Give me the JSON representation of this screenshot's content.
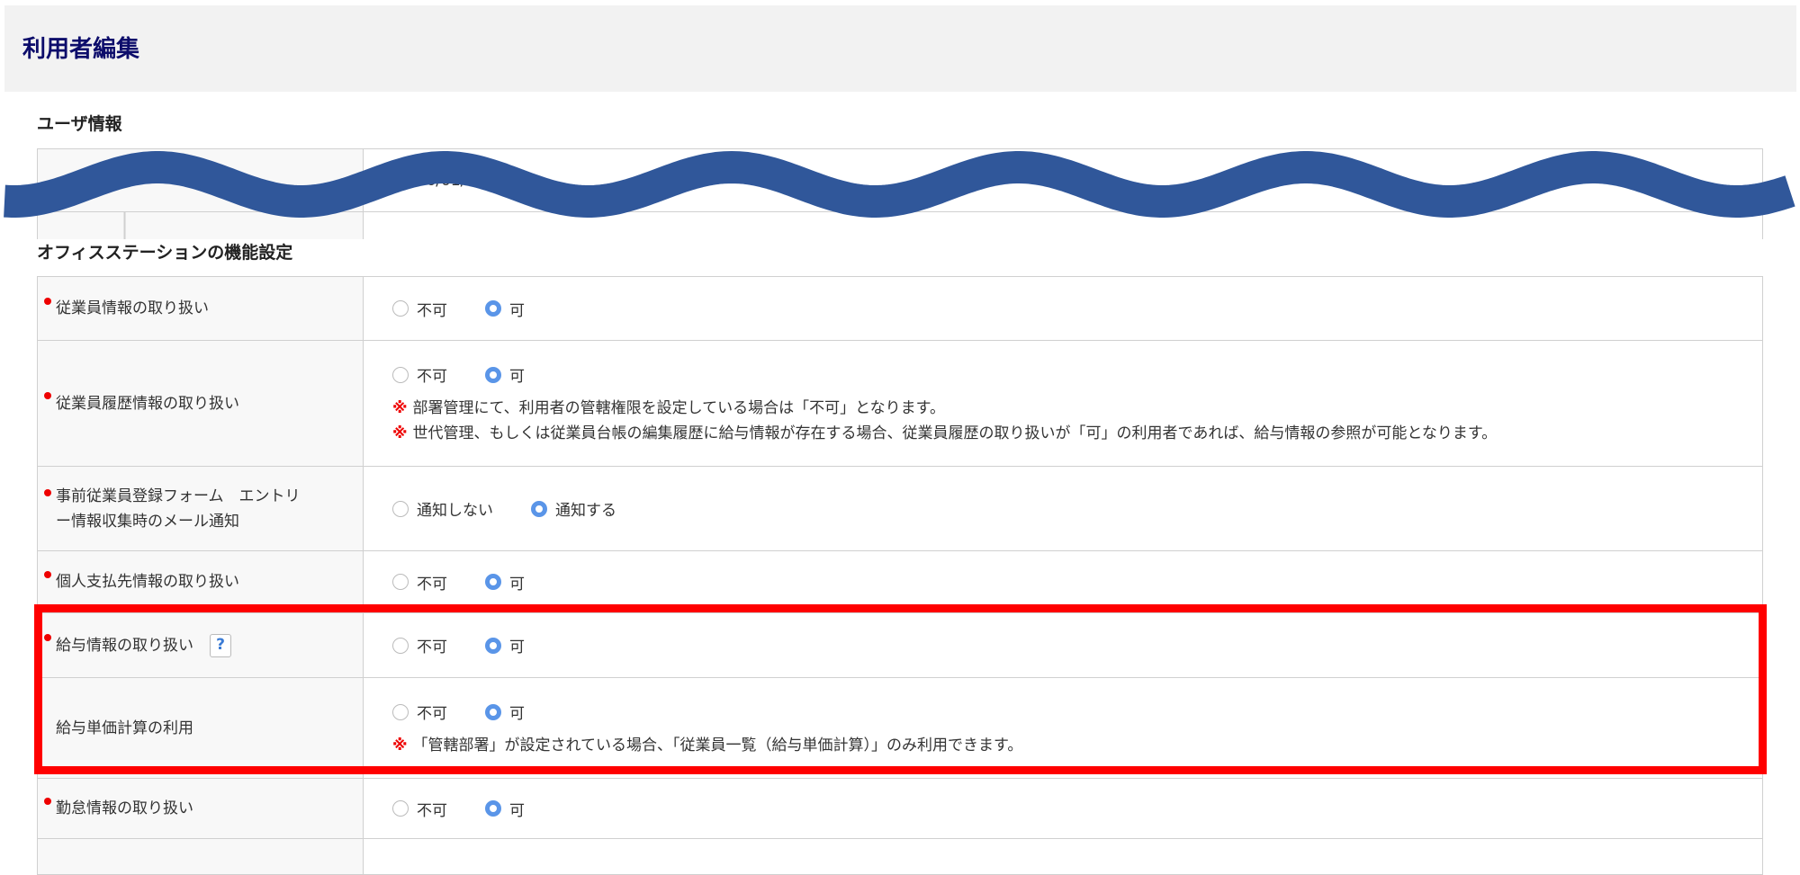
{
  "header": {
    "title": "利用者編集"
  },
  "user_info": {
    "heading": "ユーザ情報",
    "date_value": "2026/01/"
  },
  "functions": {
    "heading": "オフィスステーションの機能設定",
    "rows": [
      {
        "label": "従業員情報の取り扱い",
        "required": true,
        "options": [
          "不可",
          "可"
        ],
        "selected": 1
      },
      {
        "label": "従業員履歴情報の取り扱い",
        "required": true,
        "options": [
          "不可",
          "可"
        ],
        "selected": 1,
        "notes": [
          "部署管理にて、利用者の管轄権限を設定している場合は「不可」となります。",
          "世代管理、もしくは従業員台帳の編集履歴に給与情報が存在する場合、従業員履歴の取り扱いが「可」の利用者であれば、給与情報の参照が可能となります。"
        ]
      },
      {
        "label": "事前従業員登録フォーム　エントリー情報収集時のメール通知",
        "required": true,
        "options": [
          "通知しない",
          "通知する"
        ],
        "selected": 1
      },
      {
        "label": "個人支払先情報の取り扱い",
        "required": true,
        "options": [
          "不可",
          "可"
        ],
        "selected": 1
      },
      {
        "label": "給与情報の取り扱い",
        "required": true,
        "options": [
          "不可",
          "可"
        ],
        "selected": 1,
        "help": "?"
      },
      {
        "label": "給与単価計算の利用",
        "required": false,
        "options": [
          "不可",
          "可"
        ],
        "selected": 1,
        "notes": [
          "「管轄部署」が設定されている場合、「従業員一覧（給与単価計算）」のみ利用できます。"
        ]
      },
      {
        "label": "勤怠情報の取り扱い",
        "required": true,
        "options": [
          "不可",
          "可"
        ],
        "selected": 1
      }
    ],
    "note_mark": "※"
  },
  "colors": {
    "wave": "#30579a",
    "highlight": "#ff0000",
    "radio": "#5a95e8"
  }
}
